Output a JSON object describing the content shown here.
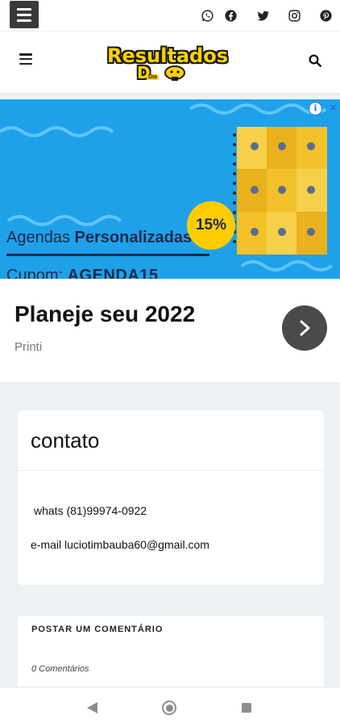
{
  "site": {
    "logo_text": "Resultados",
    "logo_letter": "D",
    "logo_small": "Dia"
  },
  "topbar": {
    "social_icons": [
      "whatsapp-icon",
      "facebook-icon",
      "twitter-icon",
      "instagram-icon",
      "pinterest-icon"
    ]
  },
  "ad": {
    "line1_regular": "Agendas ",
    "line1_bold": "Personalizadas",
    "line2_regular": "Cupom:  ",
    "line2_bold": "AGENDA15",
    "badge": "15%",
    "info_glyph": "i",
    "close_glyph": "×",
    "colors": {
      "background": "#1fa1ea",
      "planner": "#f3c12a",
      "badge": "#ffcc00"
    }
  },
  "cta": {
    "title": "Planeje seu 2022",
    "subtitle": "Printi"
  },
  "post": {
    "title": "contato",
    "line1": "whats (81)99974-0922",
    "line2": "e-mail luciotimbauba60@gmail.com"
  },
  "comments": {
    "title": "POSTAR UM COMENTÁRIO",
    "count": "0 Comentários"
  }
}
